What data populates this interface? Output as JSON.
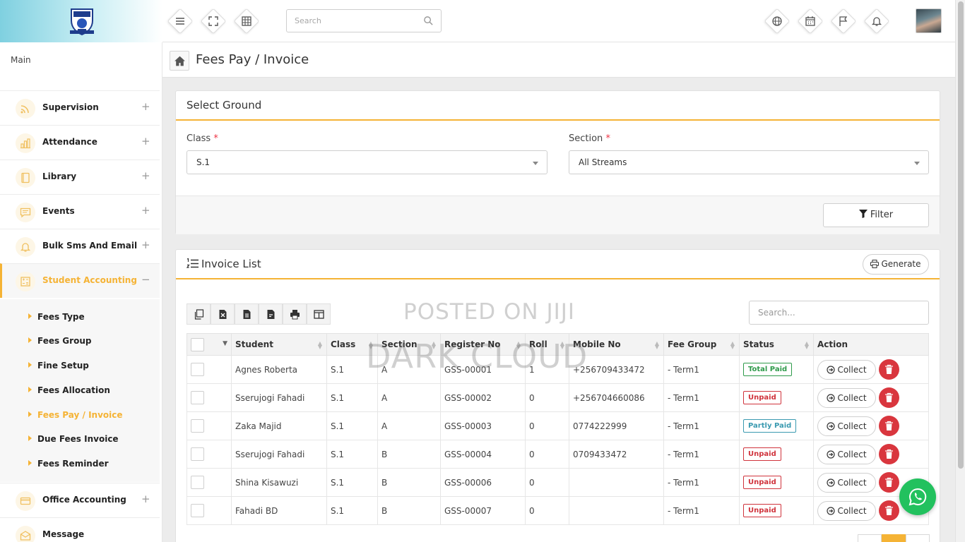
{
  "topbar": {
    "search_placeholder": "Search",
    "icons": [
      "menu-icon",
      "fullscreen-icon",
      "grid-icon",
      "globe-icon",
      "calendar-icon",
      "flag-icon",
      "bell-icon"
    ]
  },
  "sidebar": {
    "section_label": "Main",
    "items": [
      {
        "label": "Supervision",
        "icon": "rss-icon",
        "toggle": "+"
      },
      {
        "label": "Attendance",
        "icon": "bar-chart-icon",
        "toggle": "+"
      },
      {
        "label": "Library",
        "icon": "book-icon",
        "toggle": "+"
      },
      {
        "label": "Events",
        "icon": "message-icon",
        "toggle": "+"
      },
      {
        "label": "Bulk Sms And Email",
        "icon": "bell-icon",
        "toggle": "+"
      },
      {
        "label": "Student Accounting",
        "icon": "calculator-icon",
        "toggle": "−"
      },
      {
        "label": "Office Accounting",
        "icon": "credit-card-icon",
        "toggle": "+"
      },
      {
        "label": "Message",
        "icon": "envelope-icon",
        "toggle": ""
      }
    ],
    "subitems": [
      "Fees Type",
      "Fees Group",
      "Fine Setup",
      "Fees Allocation",
      "Fees Pay / Invoice",
      "Due Fees Invoice",
      "Fees Reminder"
    ]
  },
  "page": {
    "title": "Fees Pay / Invoice"
  },
  "select_ground": {
    "title": "Select Ground",
    "class_label": "Class",
    "class_value": "S.1",
    "section_label": "Section",
    "section_value": "All Streams",
    "required_mark": "*",
    "filter_label": "Filter"
  },
  "invoice_list": {
    "title": "Invoice List",
    "generate_label": "Generate",
    "search_placeholder": "Search...",
    "toolbar_icons": [
      "copy-icon",
      "excel-icon",
      "csv-icon",
      "pdf-icon",
      "print-icon",
      "columns-icon"
    ],
    "columns": [
      "Student",
      "Class",
      "Section",
      "Register No",
      "Roll",
      "Mobile No",
      "Fee Group",
      "Status",
      "Action"
    ],
    "collect_label": "Collect",
    "rows": [
      {
        "student": "Agnes Roberta",
        "class": "S.1",
        "section": "A",
        "register": "GSS-00001",
        "roll": "1",
        "mobile": "+256709433472",
        "group": "- Term1",
        "status": "Total Paid",
        "status_type": "total"
      },
      {
        "student": "Sserujogi Fahadi",
        "class": "S.1",
        "section": "A",
        "register": "GSS-00002",
        "roll": "0",
        "mobile": "+256704660086",
        "group": "- Term1",
        "status": "Unpaid",
        "status_type": "unpaid"
      },
      {
        "student": "Zaka Majid",
        "class": "S.1",
        "section": "A",
        "register": "GSS-00003",
        "roll": "0",
        "mobile": "0774222999",
        "group": "- Term1",
        "status": "Partly Paid",
        "status_type": "partly"
      },
      {
        "student": "Sserujogi Fahadi",
        "class": "S.1",
        "section": "B",
        "register": "GSS-00004",
        "roll": "0",
        "mobile": "0709433472",
        "group": "- Term1",
        "status": "Unpaid",
        "status_type": "unpaid"
      },
      {
        "student": "Shina Kisawuzi",
        "class": "S.1",
        "section": "B",
        "register": "GSS-00006",
        "roll": "0",
        "mobile": "",
        "group": "- Term1",
        "status": "Unpaid",
        "status_type": "unpaid"
      },
      {
        "student": "Fahadi BD",
        "class": "S.1",
        "section": "B",
        "register": "GSS-00007",
        "roll": "0",
        "mobile": "",
        "group": "- Term1",
        "status": "Unpaid",
        "status_type": "unpaid"
      }
    ]
  },
  "watermark": {
    "line1": "POSTED ON JIJI",
    "line2": "DARK CLOUD"
  },
  "colors": {
    "accent": "#f5b335",
    "danger": "#d9363e",
    "success": "#2e9a4a",
    "info": "#3a9ab0",
    "whatsapp": "#22c15e"
  }
}
